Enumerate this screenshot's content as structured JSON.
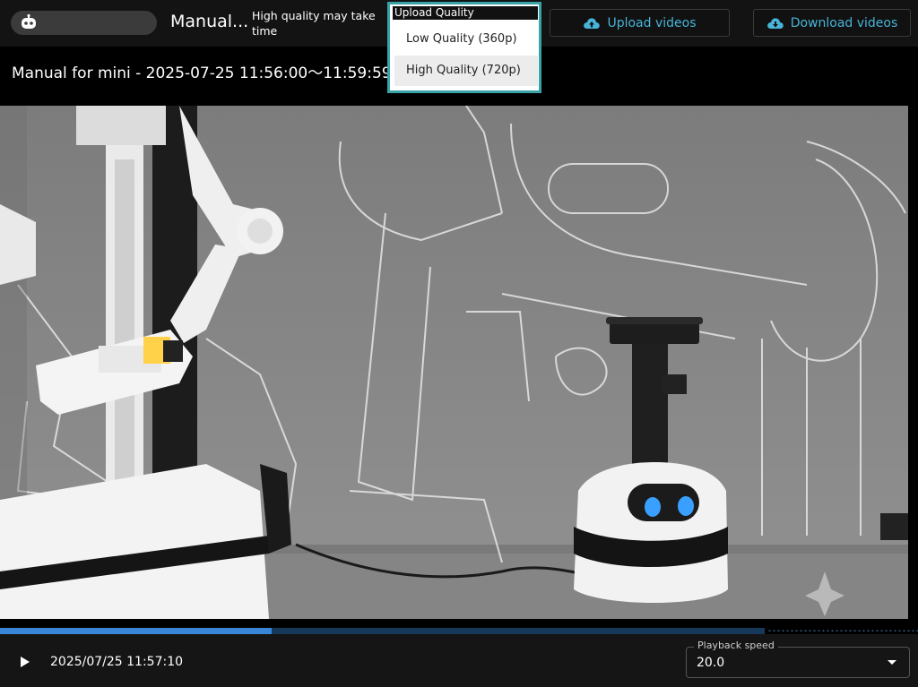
{
  "header": {
    "title_short": "Manual...",
    "hint": "High quality may take time",
    "upload_label": "Upload videos",
    "download_label": "Download videos"
  },
  "upload_quality": {
    "title": "Upload Quality",
    "options": [
      "Low Quality (360p)",
      "High Quality (720p)"
    ],
    "highlighted": "High Quality (720p)"
  },
  "video": {
    "title": "Manual for mini - 2025-07-25 11:56:00〜11:59:59",
    "progress_fraction": 0.296,
    "buffered_fraction": 0.833
  },
  "controls": {
    "timestamp": "2025/07/25 11:57:10",
    "speed_label": "Playback speed",
    "speed_value": "20.0"
  },
  "colors": {
    "accent": "#47b4d8",
    "progress": "#3a86d6",
    "dropdown_border": "#3aa3a8"
  },
  "icons": {
    "app": "robot-icon",
    "upload": "cloud-upload-icon",
    "download": "cloud-download-icon",
    "play": "play-icon",
    "speed_caret": "caret-down-icon"
  }
}
